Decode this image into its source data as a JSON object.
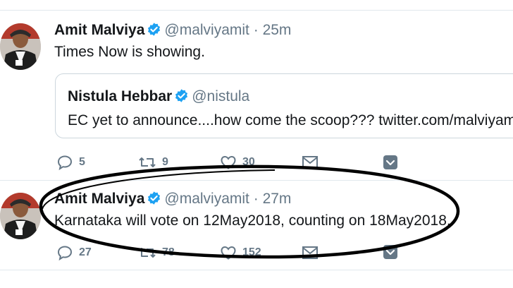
{
  "tweets": [
    {
      "name": "Amit Malviya",
      "handle": "@malviyamit",
      "separator": "·",
      "time": "25m",
      "text": "Times Now is showing.",
      "quote": {
        "name": "Nistula Hebbar",
        "handle": "@nistula",
        "text": "EC yet to announce....how come the scoop??? twitter.com/malviyamit/st"
      },
      "actions": {
        "reply": "5",
        "retweet": "9",
        "like": "30"
      }
    },
    {
      "name": "Amit Malviya",
      "handle": "@malviyamit",
      "separator": "·",
      "time": "27m",
      "text": "Karnataka will vote on 12May2018, counting on 18May2018.",
      "actions": {
        "reply": "27",
        "retweet": "78",
        "like": "152"
      }
    }
  ],
  "icons": {
    "reply": "reply-icon",
    "retweet": "retweet-icon",
    "like": "heart-icon",
    "message": "envelope-icon",
    "more": "chevron-down-icon",
    "verified": "verified-badge-icon"
  },
  "colors": {
    "verified": "#1da1f2",
    "secondary_text": "#657786",
    "annotation": "#000000"
  }
}
